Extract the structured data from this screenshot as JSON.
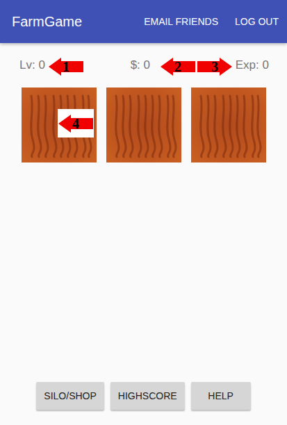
{
  "app_bar": {
    "title": "FarmGame",
    "actions": [
      "EMAIL FRIENDS",
      "LOG OUT"
    ]
  },
  "stats": [
    {
      "label": "Lv:",
      "value": "0"
    },
    {
      "label": "$:",
      "value": "0"
    },
    {
      "label": "Exp:",
      "value": "0"
    }
  ],
  "plots": [
    {
      "planted": false
    },
    {
      "planted": false
    },
    {
      "planted": false
    }
  ],
  "annotations": [
    {
      "label": "1",
      "direction": "left",
      "boxed": false
    },
    {
      "label": "2",
      "direction": "left",
      "boxed": false
    },
    {
      "label": "3",
      "direction": "right",
      "boxed": false
    },
    {
      "label": "4",
      "direction": "left",
      "boxed": true
    }
  ],
  "buttons": [
    "SILO/SHOP",
    "HIGHSCORE",
    "HELP"
  ]
}
